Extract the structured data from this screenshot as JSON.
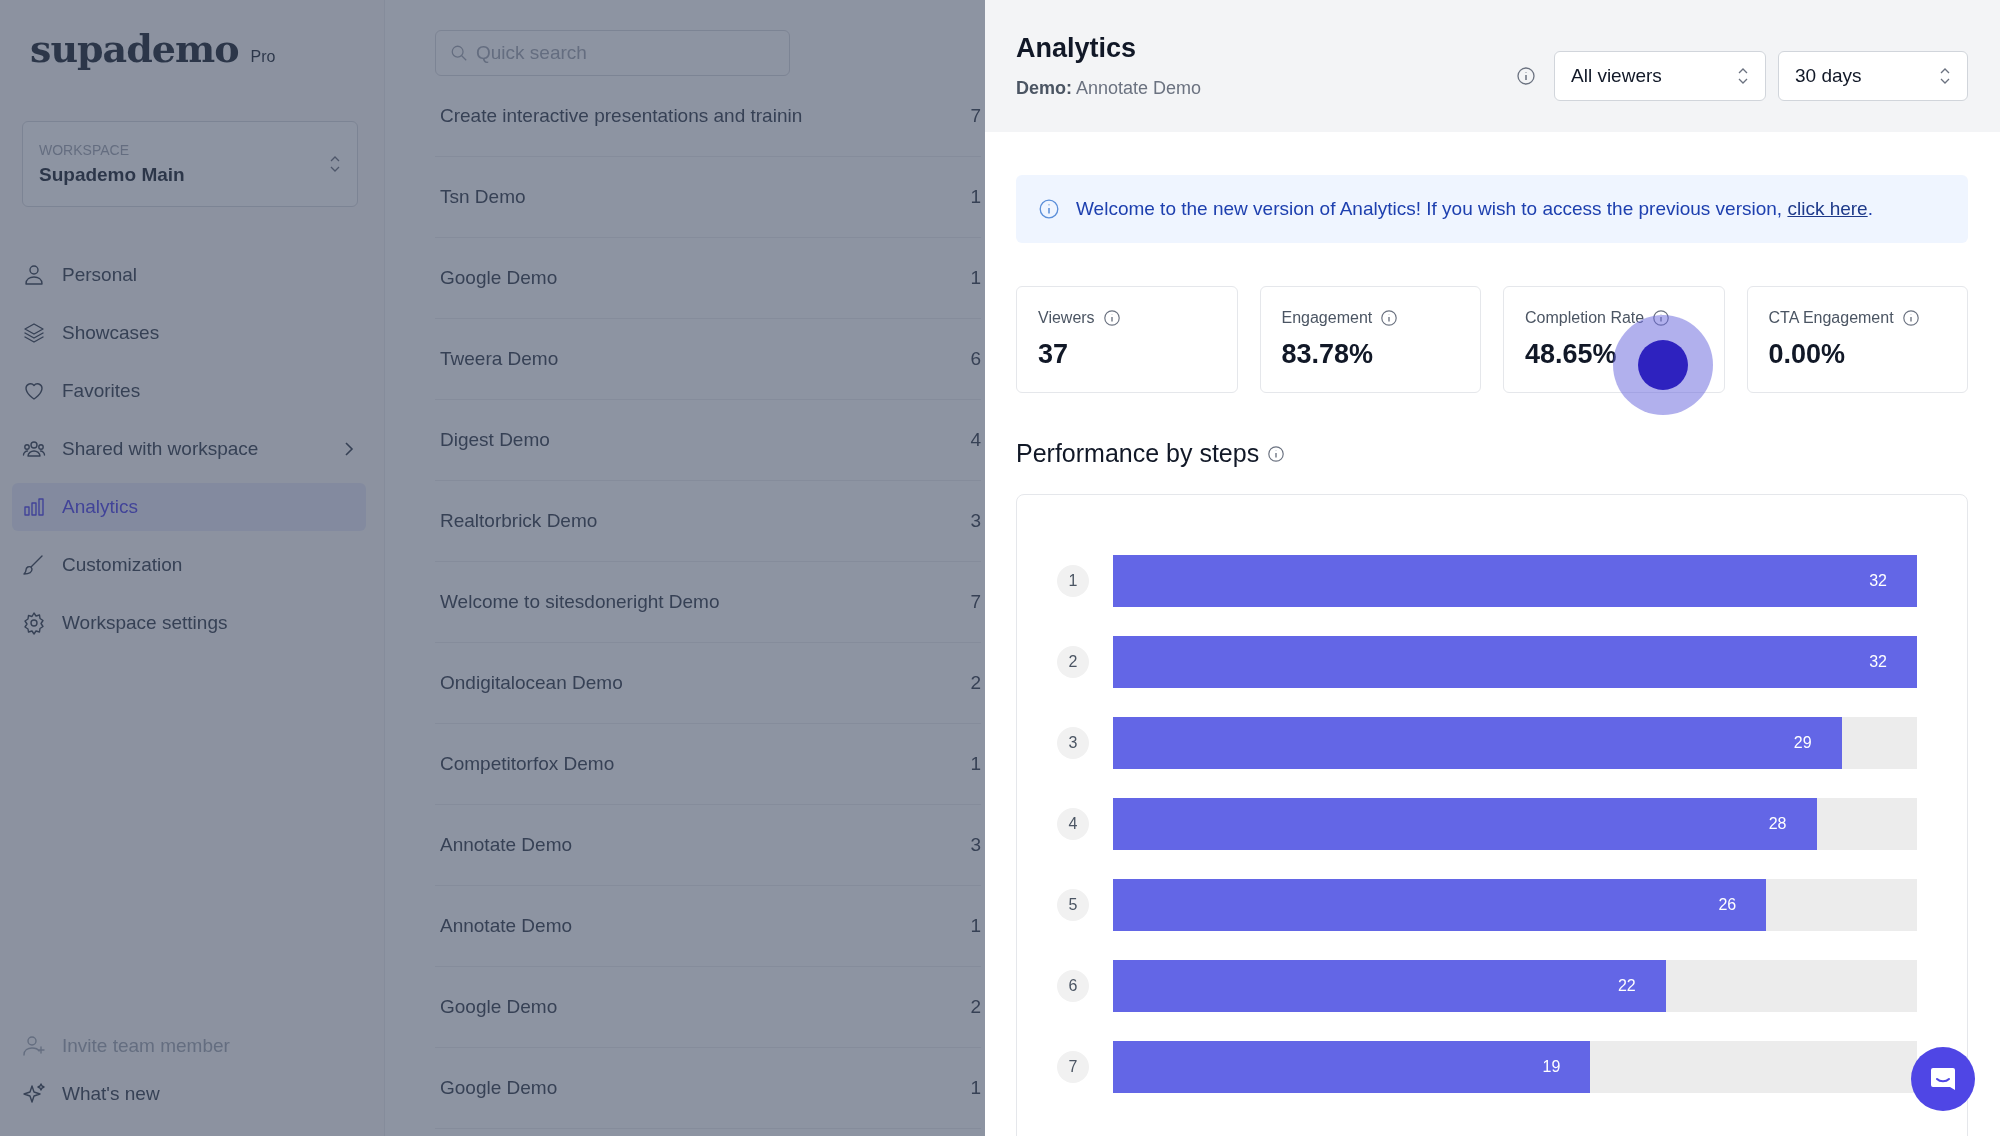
{
  "sidebar": {
    "logo": "supademo",
    "plan": "Pro",
    "workspace": {
      "label": "WORKSPACE",
      "value": "Supademo Main"
    },
    "items": [
      {
        "label": "Personal",
        "selected": false,
        "has_submenu": false
      },
      {
        "label": "Showcases",
        "selected": false,
        "has_submenu": false
      },
      {
        "label": "Favorites",
        "selected": false,
        "has_submenu": false
      },
      {
        "label": "Shared with workspace",
        "selected": false,
        "has_submenu": true
      },
      {
        "label": "Analytics",
        "selected": true,
        "has_submenu": false
      },
      {
        "label": "Customization",
        "selected": false,
        "has_submenu": false
      },
      {
        "label": "Workspace settings",
        "selected": false,
        "has_submenu": false
      }
    ],
    "footer": [
      {
        "label": "Invite team member",
        "disabled": true
      },
      {
        "label": "What's new",
        "disabled": false
      }
    ]
  },
  "search": {
    "placeholder": "Quick search"
  },
  "demos": [
    {
      "name": "Create interactive presentations and trainin",
      "column_2": "7"
    },
    {
      "name": "Tsn Demo",
      "column_2": "1"
    },
    {
      "name": "Google Demo",
      "column_2": "1"
    },
    {
      "name": "Tweera Demo",
      "column_2": "6"
    },
    {
      "name": "Digest Demo",
      "column_2": "4"
    },
    {
      "name": "Realtorbrick Demo",
      "column_2": "3"
    },
    {
      "name": "Welcome to sitesdoneright Demo",
      "column_2": "7"
    },
    {
      "name": "Ondigitalocean Demo",
      "column_2": "2"
    },
    {
      "name": "Competitorfox Demo",
      "column_2": "1"
    },
    {
      "name": "Annotate Demo",
      "column_2": "3"
    },
    {
      "name": "Annotate Demo",
      "column_2": "1"
    },
    {
      "name": "Google Demo",
      "column_2": "2"
    },
    {
      "name": "Google Demo",
      "column_2": "1"
    }
  ],
  "panel": {
    "title": "Analytics",
    "subtitle_label": "Demo:",
    "subtitle_value": "Annotate Demo",
    "filters": [
      {
        "value": "All viewers"
      },
      {
        "value": "30 days"
      }
    ],
    "banner": {
      "text": "Welcome to the new version of Analytics! If you wish to access the previous version,",
      "link": "click here",
      "end": "."
    },
    "metrics": [
      {
        "label": "Viewers",
        "value": "37"
      },
      {
        "label": "Engagement",
        "value": "83.78%"
      },
      {
        "label": "Completion Rate",
        "value": "48.65%"
      },
      {
        "label": "CTA Engagement",
        "value": "0.00%"
      }
    ],
    "section_title": "Performance by steps",
    "chart_data": {
      "type": "bar",
      "orientation": "horizontal",
      "categories": [
        "1",
        "2",
        "3",
        "4",
        "5",
        "6",
        "7"
      ],
      "values": [
        32,
        32,
        29,
        28,
        26,
        22,
        19
      ],
      "xlim": [
        0,
        32
      ],
      "data_labels": true
    }
  }
}
